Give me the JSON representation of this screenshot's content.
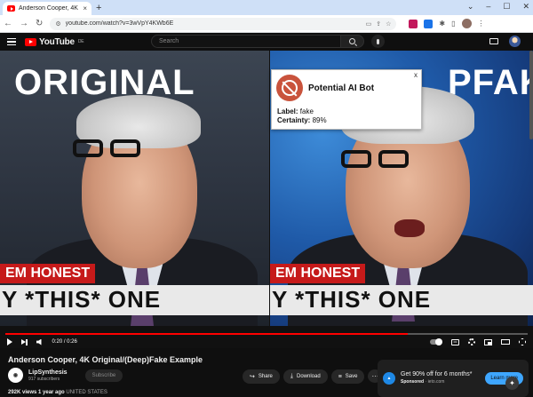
{
  "browser": {
    "tab_title": "Anderson Cooper, 4K Origi",
    "url": "youtube.com/watch?v=3wVpY4KWb6E"
  },
  "youtube": {
    "logo": "YouTube",
    "logo_country": "DE",
    "search_placeholder": "Search"
  },
  "video": {
    "left_label": "ORIGINAL",
    "right_label": "PFAKE",
    "lower_red_left": "EM HONEST",
    "lower_red_right": "EM HONEST",
    "lower_white_left": "Y *THIS* ONE",
    "lower_white_right": "Y *THIS* ONE",
    "time": "0:20 / 0:26",
    "progress": 0.77
  },
  "popup": {
    "close": "x",
    "title": "Potential AI Bot",
    "label_key": "Label:",
    "label_value": "fake",
    "certainty_key": "Certainty:",
    "certainty_value": "89%"
  },
  "meta": {
    "title": "Anderson Cooper, 4K Original/(Deep)Fake Example",
    "channel": "LipSynthesis",
    "subscribers": "917 subscribers",
    "subscribe": "Subscribe",
    "share": "Share",
    "download": "Download",
    "save": "Save",
    "more": "···",
    "views": "292K views",
    "date": "1 year ago",
    "location": "UNITED STATES"
  },
  "ad": {
    "text": "Get 90% off for 6 months*",
    "sponsored": "Sponsored",
    "domain": "· ieto.com",
    "cta": "Learn more"
  },
  "colors": {
    "accent_red": "#ff0000",
    "popup_logo": "#c9533c",
    "learn_more": "#3ea6ff"
  }
}
